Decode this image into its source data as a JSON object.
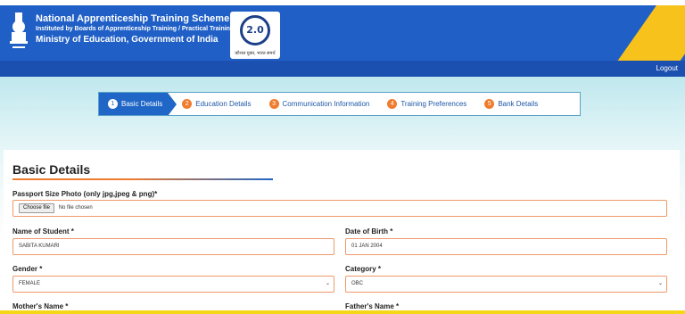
{
  "header": {
    "title": "National Apprenticeship Training Scheme (NATS)",
    "subtitle": "Instituted by Boards of Apprenticeship Training / Practical Training",
    "ministry": "Ministry of Education, Government of India",
    "logo_version": "2.0",
    "logo_tagline": "कौशल युक्त, भारत समर्थ"
  },
  "nav": {
    "logout": "Logout"
  },
  "stepper": [
    {
      "num": "1",
      "label": "Basic Details",
      "active": true
    },
    {
      "num": "2",
      "label": "Education Details"
    },
    {
      "num": "3",
      "label": "Communication Information"
    },
    {
      "num": "4",
      "label": "Training Preferences"
    },
    {
      "num": "5",
      "label": "Bank Details"
    }
  ],
  "form": {
    "title": "Basic Details",
    "photo": {
      "label": "Passport Size Photo (only jpg,jpeg & png)*",
      "button": "Choose file",
      "status": "No file chosen"
    },
    "student_name": {
      "label": "Name of Student *",
      "value": "SABITA KUMARI"
    },
    "dob": {
      "label": "Date of Birth *",
      "value": "01 JAN 2004"
    },
    "gender": {
      "label": "Gender *",
      "value": "FEMALE"
    },
    "category": {
      "label": "Category *",
      "value": "OBC"
    },
    "mother_name": {
      "label": "Mother's Name *"
    },
    "father_name": {
      "label": "Father's Name *"
    }
  },
  "colors": {
    "header_blue": "#1f5fc6",
    "accent_orange": "#ef7c2f",
    "accent_yellow": "#f7c21b"
  }
}
